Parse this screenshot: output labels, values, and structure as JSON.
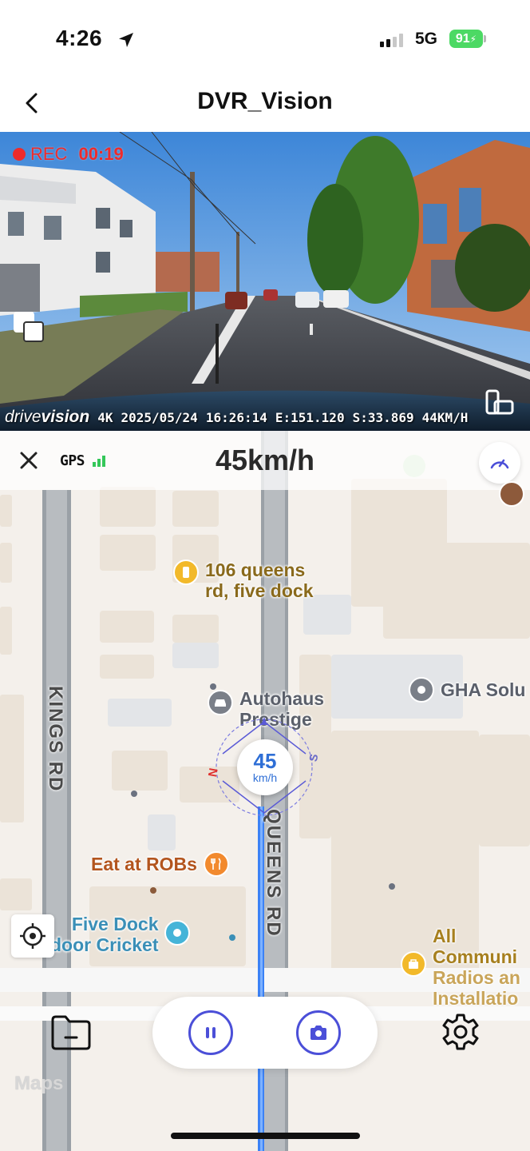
{
  "status_bar": {
    "time": "4:26",
    "network": "5G",
    "battery": "91"
  },
  "header": {
    "title": "DVR_Vision"
  },
  "video": {
    "rec_label": "REC",
    "rec_time": "00:19",
    "overlay": {
      "brand_prefix": "drive",
      "brand_suffix": "vision",
      "resolution": "4K",
      "date": "2025/05/24",
      "time": "16:26:14",
      "east": "E:151.120",
      "south": "S:33.869",
      "speed": "44KM/H"
    }
  },
  "map": {
    "gps_label": "GPS",
    "speed_title": "45km/h",
    "pois": [
      {
        "line1": "106 queens",
        "line2": "rd, five dock",
        "color": "#8a6a1c"
      },
      {
        "line1": "Autohaus",
        "line2": "Prestige",
        "color": "#5a5f6a"
      },
      {
        "line1": "GHA Solu",
        "line2": "",
        "color": "#5a5f6a"
      },
      {
        "line1": "Eat at ROBs",
        "line2": "",
        "color": "#b3551e"
      },
      {
        "line1": "Five Dock",
        "line2": "door Cricket",
        "color": "#3a8fb7"
      },
      {
        "line1": "All",
        "line2": "Communi",
        "line3": "Radios an",
        "line4": "Installatio",
        "color": "#a7801f"
      }
    ],
    "streets": {
      "kings": "KINGS RD",
      "queens": "QUEENS RD"
    },
    "compass": {
      "speed": "45",
      "unit": "km/h",
      "n": "N",
      "s": "S"
    },
    "attribution": "Maps"
  },
  "colors": {
    "accent": "#4b4fd8",
    "rec": "#ee2b2b",
    "gps_ok": "#34c759",
    "speed_blue": "#2f6fd6"
  }
}
